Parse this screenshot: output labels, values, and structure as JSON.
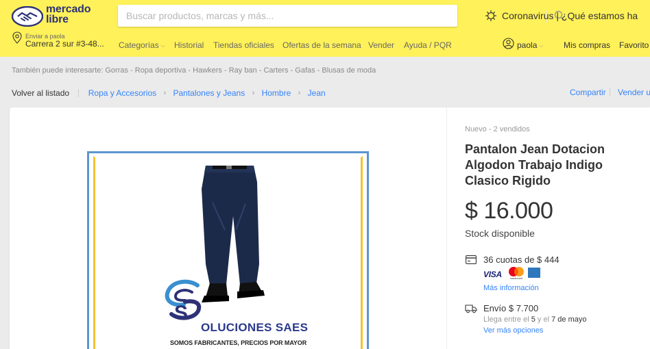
{
  "header": {
    "logo": {
      "line1": "mercado",
      "line2": "libre"
    },
    "search_placeholder": "Buscar productos, marcas y más...",
    "promo_text": "Coronavirus | ¿Qué estamos ha"
  },
  "location": {
    "label": "Enviar a paola",
    "address": "Carrera 2 sur #3-48..."
  },
  "nav": {
    "categories": "Categorías",
    "history": "Historial",
    "official_stores": "Tiendas oficiales",
    "deals": "Ofertas de la semana",
    "sell": "Vender",
    "help": "Ayuda / PQR"
  },
  "user": {
    "name": "paola",
    "my_purchases": "Mis compras",
    "favorites": "Favorito"
  },
  "related_searches": "También puede interesarte: Gorras - Ropa deportiva - Hawkers - Ray ban - Carters - Gafas - Blusas de moda",
  "breadcrumb": {
    "back": "Volver al listado",
    "items": [
      "Ropa y Accesorios",
      "Pantalones y Jeans",
      "Hombre",
      "Jean"
    ],
    "share": "Compartir",
    "sell_similar": "Vender u"
  },
  "image": {
    "brand_letter": "S",
    "brand_text": "OLUCIONES SAES",
    "slogan": "SOMOS FABRICANTES, PRECIOS POR MAYOR"
  },
  "product": {
    "condition": "Nuevo - 2 vendidos",
    "title": "Pantalon Jean Dotacion Algodon Trabajo Indigo Clasico Rigido",
    "price": "$ 16.000",
    "stock": "Stock disponible",
    "installments": "36 cuotas de $ 444",
    "payment_visa": "VISA",
    "payment_mc_label": "mastercard",
    "more_info": "Más información",
    "shipping": "Envío $ 7.700",
    "arrival_prefix": "Llega entre el",
    "arrival_day1": "5",
    "arrival_mid": "y el",
    "arrival_day2": "7 de mayo",
    "more_options": "Ver más opciones"
  },
  "colors": {
    "header_bg": "#fff159",
    "link": "#3483fa",
    "brand_navy": "#2d3277",
    "image_frame_blue": "#5b95cf",
    "image_frame_yellow": "#f2c230"
  },
  "icons": [
    "handshake-logo-icon",
    "search-icon",
    "virus-icon",
    "location-pin-icon",
    "user-icon",
    "credit-card-icon",
    "truck-icon"
  ]
}
